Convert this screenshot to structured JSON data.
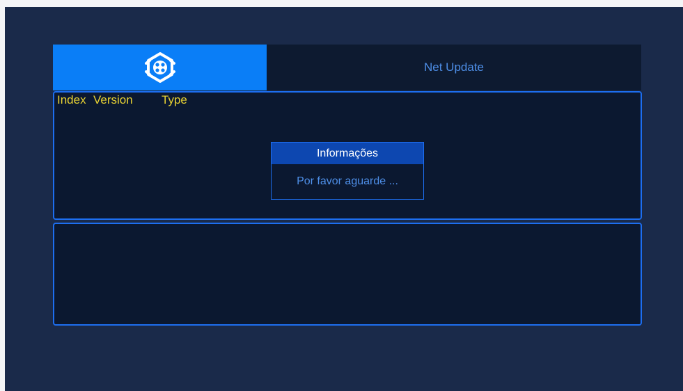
{
  "header": {
    "logo_icon": "hexagon-film-reel-icon",
    "title": "Net Update"
  },
  "list": {
    "columns": [
      "Index",
      "Version",
      "Type"
    ]
  },
  "dialog": {
    "title": "Informações",
    "message": "Por favor aguarde ..."
  },
  "colors": {
    "accent": "#0a7ef7",
    "border": "#1d6ef0",
    "header_text": "#4e8fe8",
    "column_text": "#e8d233",
    "dialog_title_bg": "#0d47b0",
    "background": "#1a2a4a",
    "panel_bg": "#0b1830"
  }
}
